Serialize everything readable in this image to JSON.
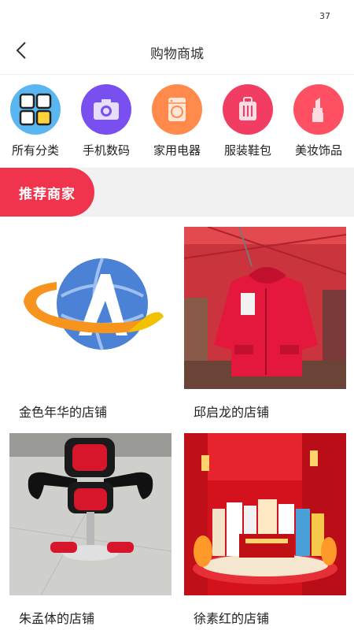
{
  "status": {
    "number": "37"
  },
  "header": {
    "title": "购物商城"
  },
  "categories": [
    {
      "label": "所有分类",
      "icon": "grid-icon",
      "color": "#5ab6f0"
    },
    {
      "label": "手机数码",
      "icon": "camera-icon",
      "color": "#7a4ff0"
    },
    {
      "label": "家用电器",
      "icon": "washer-icon",
      "color": "#ff8a4b"
    },
    {
      "label": "服装鞋包",
      "icon": "luggage-icon",
      "color": "#f23d63"
    },
    {
      "label": "美妆饰品",
      "icon": "lipstick-icon",
      "color": "#ff4f63"
    }
  ],
  "section": {
    "title": "推荐商家"
  },
  "shops": [
    {
      "name": "金色年华的店铺"
    },
    {
      "name": "邱启龙的店铺"
    },
    {
      "name": "朱孟体的店铺"
    },
    {
      "name": "徐素红的店铺"
    }
  ],
  "colors": {
    "accent": "#f0344e",
    "section_bg": "#f1f1f1"
  }
}
